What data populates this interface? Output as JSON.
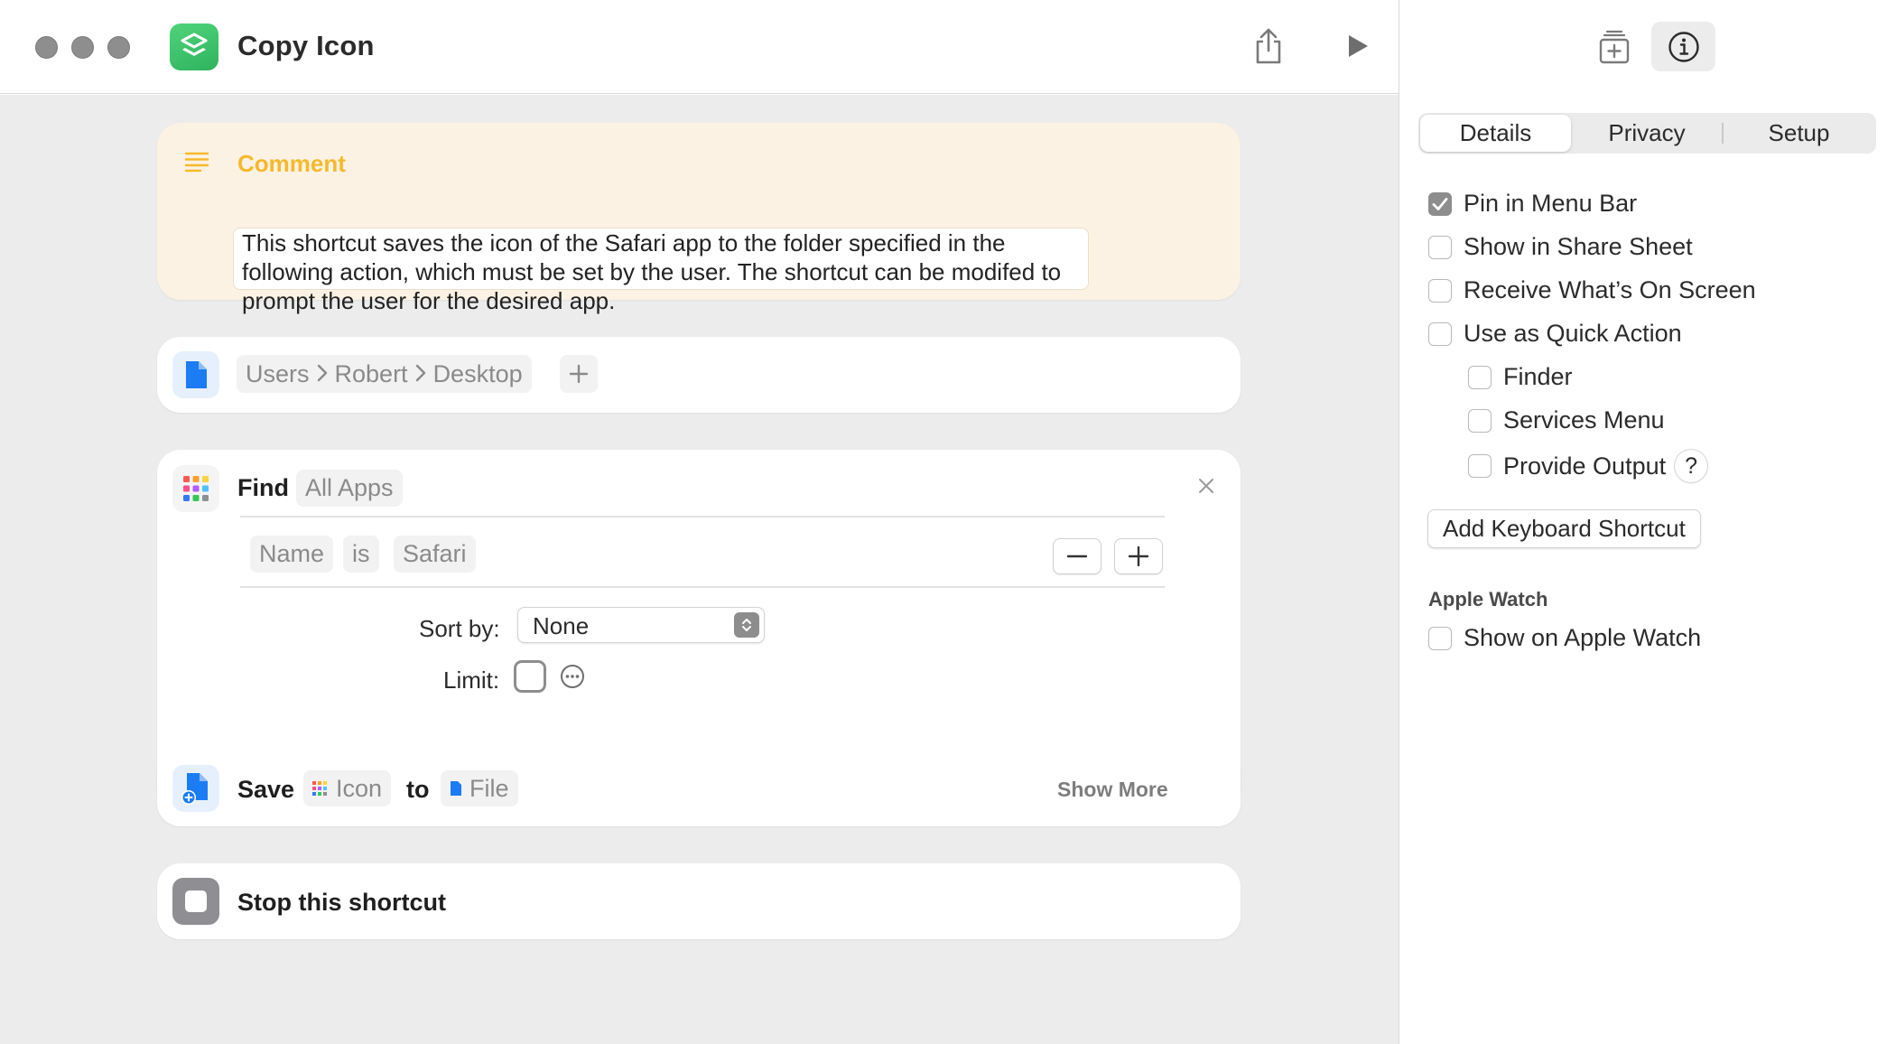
{
  "window": {
    "title": "Copy Icon"
  },
  "comment": {
    "label": "Comment",
    "text": "This shortcut saves the icon of the Safari app to the folder specified in the following action, which must be set by the user.  The shortcut can be modifed to prompt the user for the desired app."
  },
  "file_action": {
    "path": [
      "Users",
      "Robert",
      "Desktop"
    ]
  },
  "find_action": {
    "verb": "Find",
    "scope": "All Apps",
    "filter": {
      "field": "Name",
      "operator": "is",
      "value": "Safari"
    },
    "sort_label": "Sort by:",
    "sort_value": "None",
    "limit_label": "Limit:"
  },
  "save_action": {
    "verb": "Save",
    "input": "Icon",
    "preposition": "to",
    "destination": "File",
    "show_more": "Show More"
  },
  "stop_action": {
    "label": "Stop this shortcut"
  },
  "panel": {
    "tabs": [
      "Details",
      "Privacy",
      "Setup"
    ],
    "active_tab": "Details",
    "options": {
      "pin_menu_bar": {
        "label": "Pin in Menu Bar",
        "checked": true
      },
      "share_sheet": {
        "label": "Show in Share Sheet",
        "checked": false
      },
      "receive_screen": {
        "label": "Receive What’s On Screen",
        "checked": false
      },
      "quick_action": {
        "label": "Use as Quick Action",
        "checked": false
      },
      "finder": {
        "label": "Finder",
        "checked": false
      },
      "services_menu": {
        "label": "Services Menu",
        "checked": false
      },
      "provide_output": {
        "label": "Provide Output",
        "checked": false
      }
    },
    "help_glyph": "?",
    "keyboard_shortcut_button": "Add Keyboard Shortcut",
    "watch_section_title": "Apple Watch",
    "watch_option": {
      "label": "Show on Apple Watch",
      "checked": false
    }
  },
  "colors": {
    "comment_accent": "#f6b92c",
    "file_blue": "#1c7cf4",
    "app_green": "#37c46b",
    "stop_gray": "#8e8e93"
  }
}
